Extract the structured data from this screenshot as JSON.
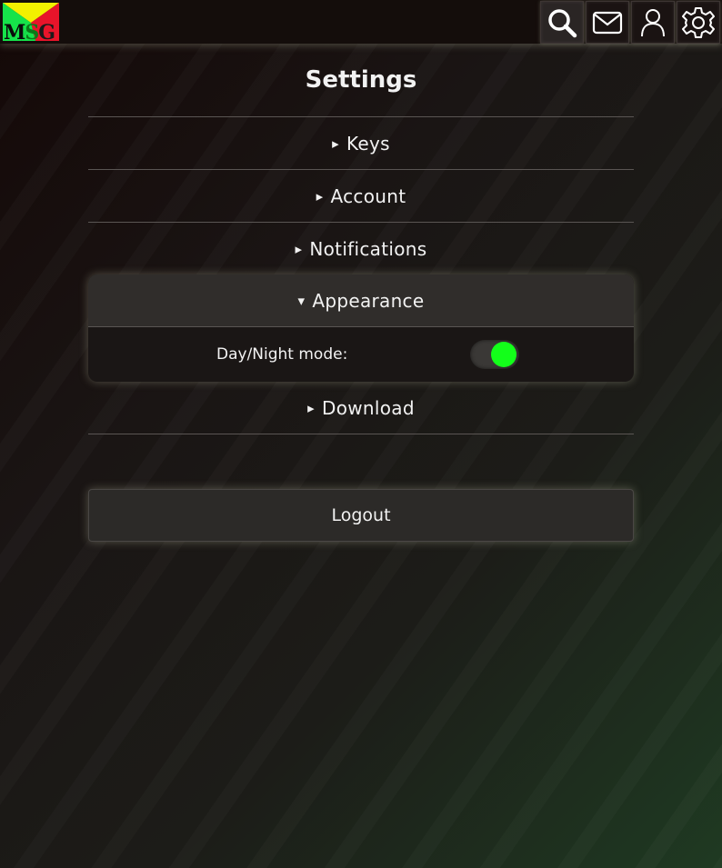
{
  "header": {
    "logo_letters": [
      "M",
      "S",
      "G"
    ],
    "nav": [
      {
        "name": "search-icon",
        "label": "Search"
      },
      {
        "name": "mail-icon",
        "label": "Messages"
      },
      {
        "name": "user-icon",
        "label": "Account"
      },
      {
        "name": "gear-icon",
        "label": "Settings"
      }
    ]
  },
  "page": {
    "title": "Settings"
  },
  "sections": [
    {
      "caret": "▸",
      "label": "Keys",
      "expanded": false
    },
    {
      "caret": "▸",
      "label": "Account",
      "expanded": false
    },
    {
      "caret": "▸",
      "label": "Notifications",
      "expanded": false
    },
    {
      "caret": "▾",
      "label": "Appearance",
      "expanded": true
    },
    {
      "caret": "▸",
      "label": "Download",
      "expanded": false
    }
  ],
  "appearance": {
    "day_night_label": "Day/Night mode:",
    "day_night_on": true
  },
  "logout": {
    "label": "Logout"
  },
  "colors": {
    "toggle_on": "#13ff1a",
    "logo_yellow": "#f2f000",
    "logo_green": "#16e34a",
    "logo_red": "#e8142a"
  }
}
